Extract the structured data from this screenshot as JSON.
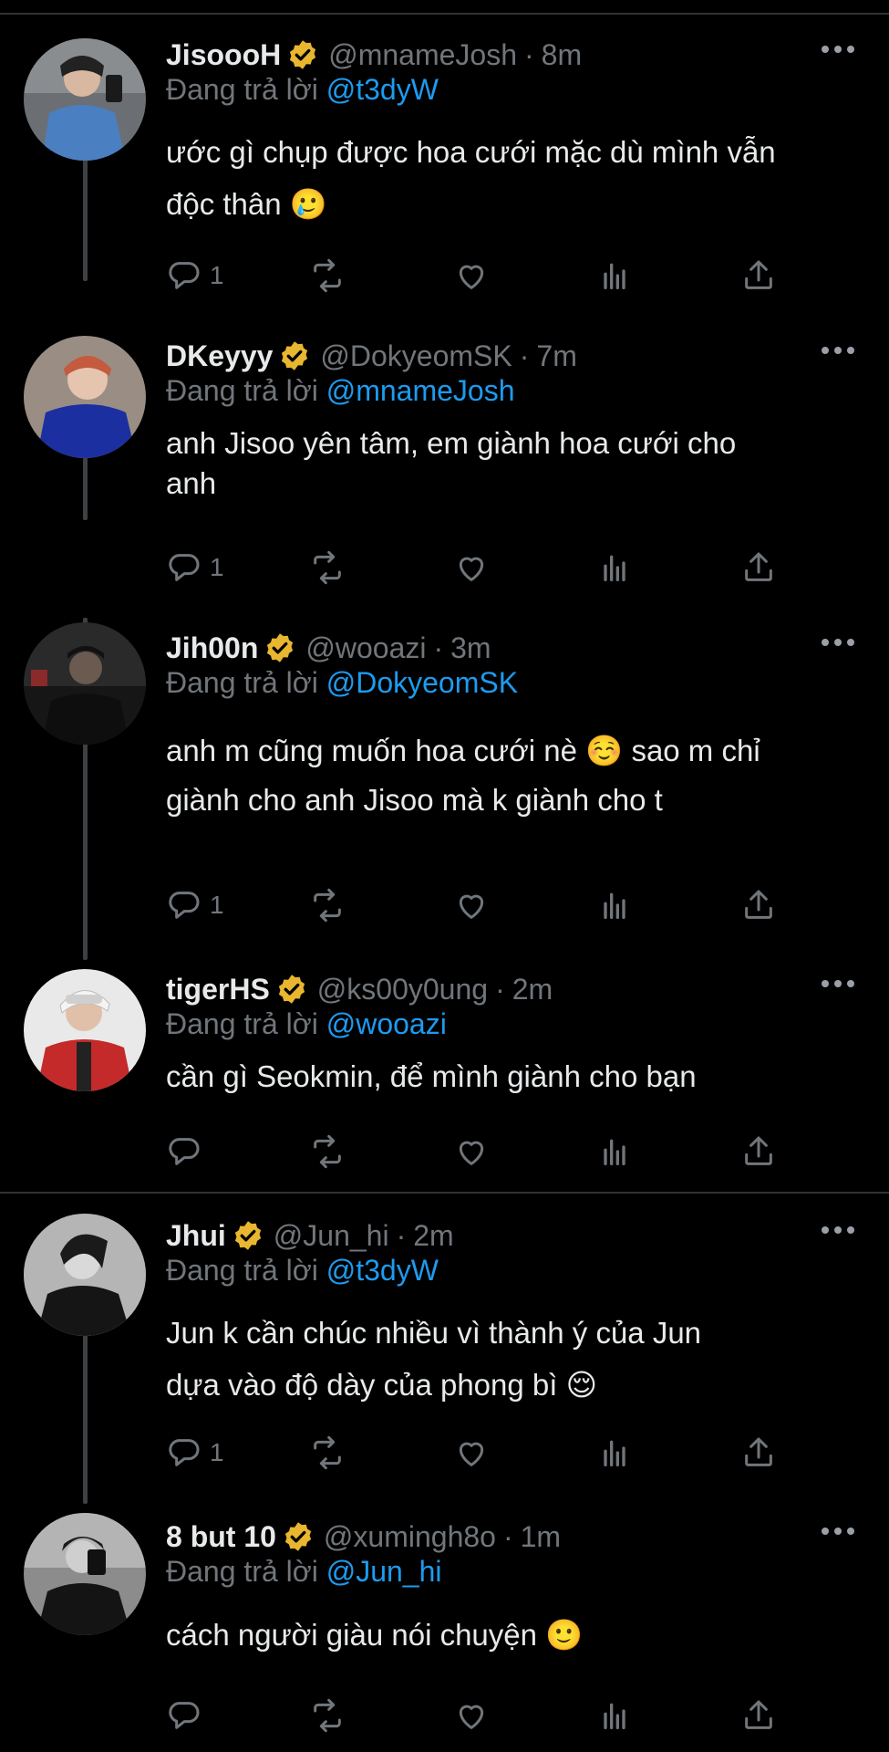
{
  "reply_prefix": "Đang trả lời",
  "icons": [
    "reply-icon",
    "retweet-icon",
    "like-icon",
    "views-icon",
    "share-icon",
    "verified-badge-icon",
    "more-icon"
  ],
  "colors": {
    "background": "#000000",
    "text": "#e7e9ea",
    "muted": "#71767b",
    "mention": "#1d9bf0",
    "badge": "#e8b62f"
  },
  "tweets": [
    {
      "name": "JisoooH",
      "handle": "@mnameJosh",
      "time": "8m",
      "reply_to": "@t3dyW",
      "body_1": "ước gì chụp được hoa cưới mặc dù mình vẫn",
      "body_2": "độc thân",
      "emoji": "🥲",
      "reply_count": "1"
    },
    {
      "name": "DKeyyy",
      "handle": "@DokyeomSK",
      "time": "7m",
      "reply_to": "@mnameJosh",
      "body_1": "anh Jisoo yên tâm, em giành hoa cưới cho",
      "body_2": "anh",
      "reply_count": "1"
    },
    {
      "name": "Jih00n",
      "handle": "@wooazi",
      "time": "3m",
      "reply_to": "@DokyeomSK",
      "body_1a": "anh m cũng muốn hoa cưới nè",
      "emoji": "☺️",
      "body_1b": "sao m chỉ",
      "body_2": "giành cho anh Jisoo mà k giành cho t",
      "reply_count": "1"
    },
    {
      "name": "tigerHS",
      "handle": "@ks00y0ung",
      "time": "2m",
      "reply_to": "@wooazi",
      "body_1": "cần gì Seokmin, để mình giành cho bạn",
      "reply_count": ""
    },
    {
      "name": "Jhui",
      "handle": "@Jun_hi",
      "time": "2m",
      "reply_to": "@t3dyW",
      "body_1": "Jun k cần chúc nhiều vì thành ý của Jun",
      "body_2": "dựa vào độ dày của phong bì",
      "emoji": "😌",
      "reply_count": "1"
    },
    {
      "name": "8 but 10",
      "handle": "@xumingh8o",
      "time": "1m",
      "reply_to": "@Jun_hi",
      "body_1": "cách người giàu nói chuyện",
      "emoji": "🙂",
      "reply_count": ""
    }
  ]
}
